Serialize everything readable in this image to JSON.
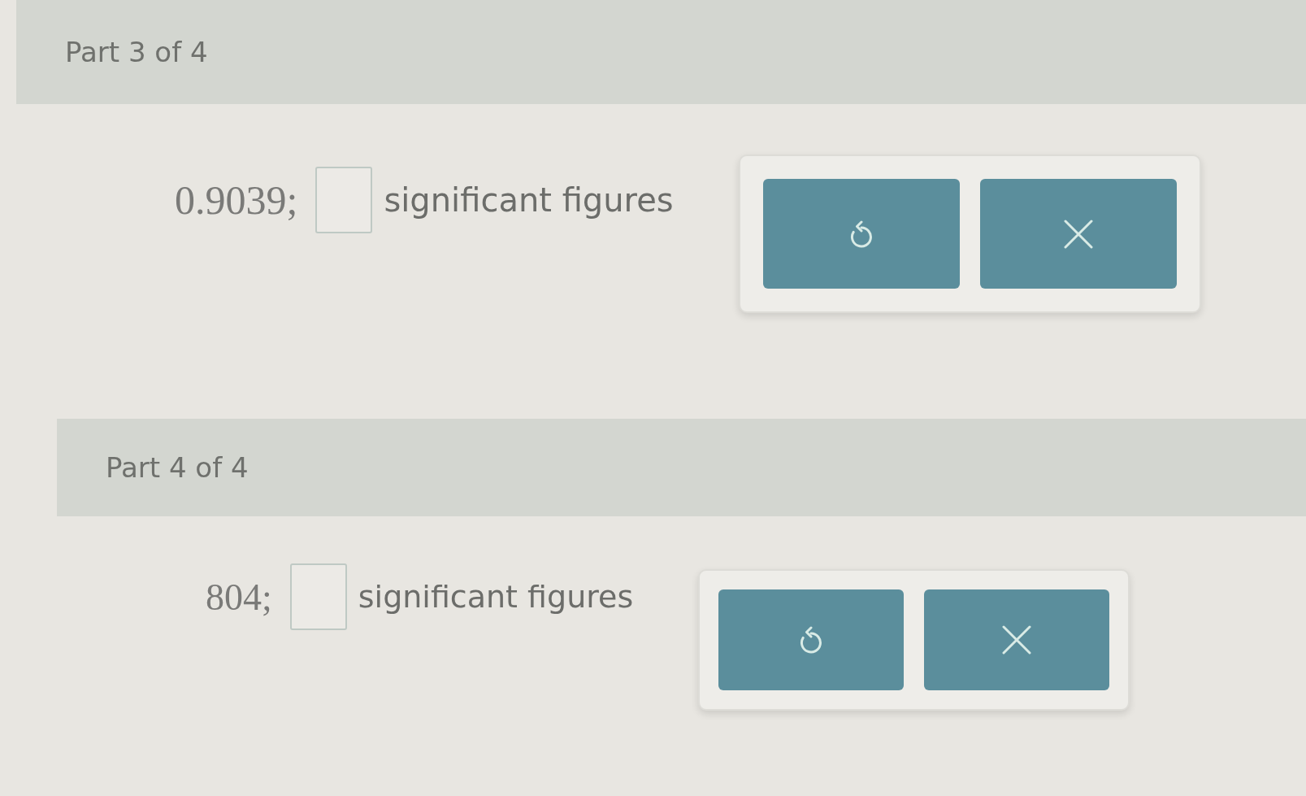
{
  "parts": [
    {
      "title": "Part 3 of 4",
      "prompt": "0.9039;",
      "suffix": "significant figures",
      "buttons": [
        {
          "kind": "undo"
        },
        {
          "kind": "clear"
        }
      ]
    },
    {
      "title": "Part 4 of 4",
      "prompt": "804;",
      "suffix": "significant figures",
      "buttons": [
        {
          "kind": "undo"
        },
        {
          "kind": "clear"
        }
      ]
    }
  ]
}
